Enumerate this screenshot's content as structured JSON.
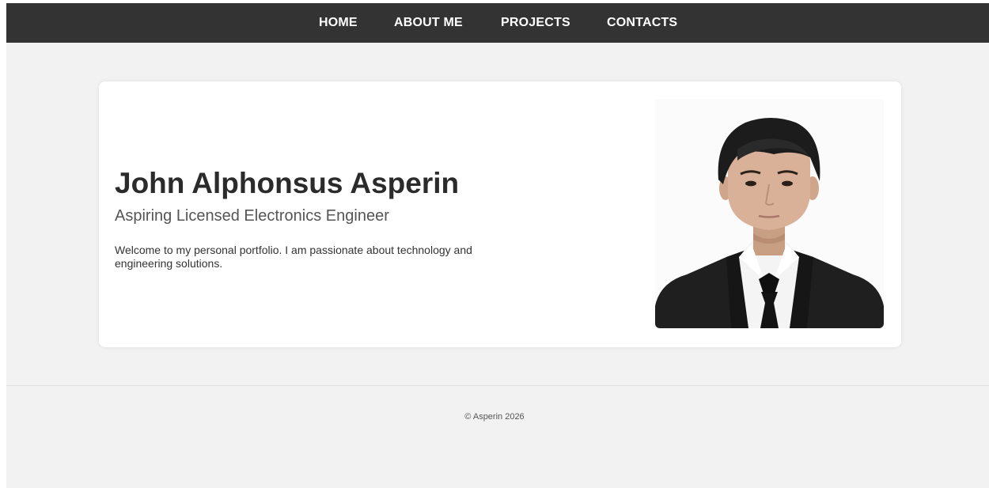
{
  "nav": {
    "items": [
      {
        "label": "HOME"
      },
      {
        "label": "ABOUT ME"
      },
      {
        "label": "PROJECTS"
      },
      {
        "label": "CONTACTS"
      }
    ]
  },
  "hero": {
    "name": "John Alphonsus Asperin",
    "role": "Aspiring Licensed Electronics Engineer",
    "intro": "Welcome to my personal portfolio. I am passionate about technology and engineering solutions."
  },
  "footer": {
    "text": "© Asperin 2026"
  },
  "colors": {
    "navbar": "#333333",
    "page_background": "#f2f2f2",
    "card": "#ffffff",
    "suit": "#1f1f1f",
    "hair": "#1c1c1c",
    "skin": "#d9b199"
  },
  "icons": {
    "profile_photo": "profile-photo-image"
  }
}
